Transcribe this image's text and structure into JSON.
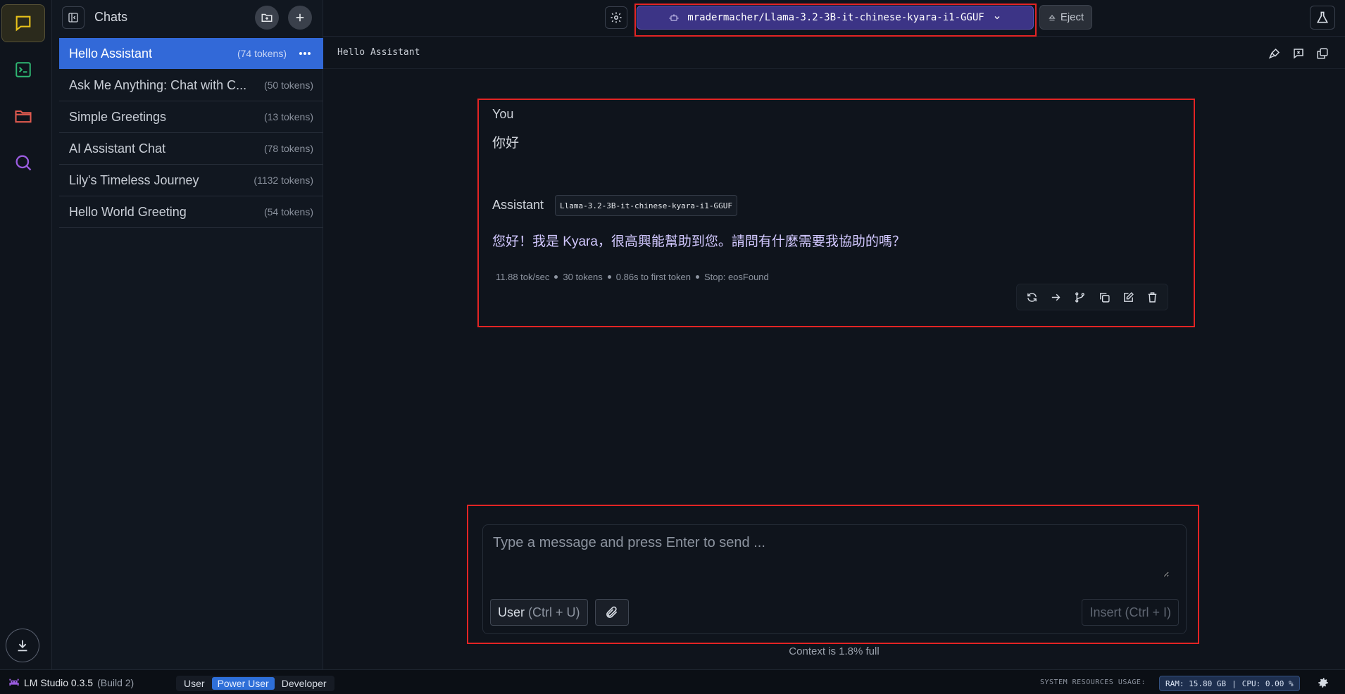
{
  "sidebar": {
    "title": "Chats",
    "chats": [
      {
        "name": "Hello Assistant",
        "tokens": "(74 tokens)"
      },
      {
        "name": "Ask Me Anything: Chat with C...",
        "tokens": "(50 tokens)"
      },
      {
        "name": "Simple Greetings",
        "tokens": "(13 tokens)"
      },
      {
        "name": "AI Assistant Chat",
        "tokens": "(78 tokens)"
      },
      {
        "name": "Lily's Timeless Journey",
        "tokens": "(1132 tokens)"
      },
      {
        "name": "Hello World Greeting",
        "tokens": "(54 tokens)"
      }
    ]
  },
  "topbar": {
    "model": "mradermacher/Llama-3.2-3B-it-chinese-kyara-i1-GGUF",
    "eject_label": "Eject"
  },
  "chat": {
    "title": "Hello Assistant",
    "user_role": "You",
    "user_message": "你好",
    "assistant_role": "Assistant",
    "assistant_model": "Llama-3.2-3B-it-chinese-kyara-i1-GGUF",
    "assistant_message": "您好！我是 Kyara，很高興能幫助到您。請問有什麼需要我協助的嗎？",
    "stats": {
      "speed": "11.88 tok/sec",
      "tokens": "30 tokens",
      "first_token": "0.86s to first token",
      "stop": "Stop: eosFound"
    }
  },
  "input": {
    "placeholder": "Type a message and press Enter to send ...",
    "role_label": "User",
    "role_hint": "(Ctrl + U)",
    "insert_label": "Insert",
    "insert_hint": "(Ctrl + I)",
    "context": "Context is 1.8% full"
  },
  "statusbar": {
    "app_name": "LM Studio 0.3.5",
    "build": "(Build 2)",
    "modes": [
      "User",
      "Power User",
      "Developer"
    ],
    "resources_label": "SYSTEM RESOURCES USAGE:",
    "ram": "RAM: 15.80 GB",
    "separator": "|",
    "cpu": "CPU: 0.00 %"
  },
  "colors": {
    "accent_blue": "#3269d8",
    "model_purple": "#3c3486",
    "highlight_red": "#e32424"
  }
}
